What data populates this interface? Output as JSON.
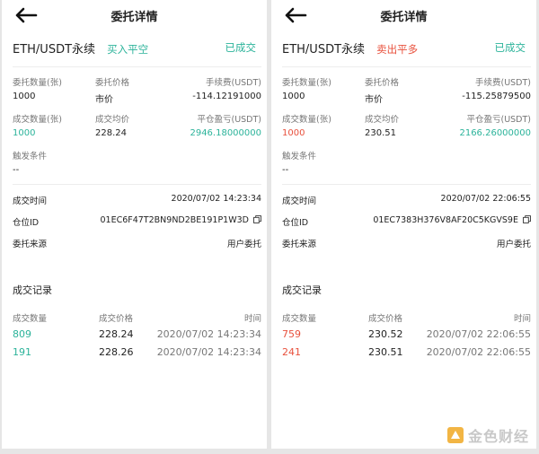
{
  "left": {
    "title": "委托详情",
    "pair": "ETH/USDT永续",
    "side": "买入平空",
    "status": "已成交",
    "labels": {
      "order_qty": "委托数量(张)",
      "order_price": "委托价格",
      "fee": "手续费(USDT)",
      "filled_qty": "成交数量(张)",
      "avg_price": "成交均价",
      "pnl": "平仓盈亏(USDT)",
      "trigger": "触发条件",
      "fill_time": "成交时间",
      "position_id": "仓位ID",
      "source": "委托来源"
    },
    "order_qty": "1000",
    "order_price": "市价",
    "fee": "-114.12191000",
    "filled_qty": "1000",
    "avg_price": "228.24",
    "pnl": "2946.18000000",
    "trigger": "--",
    "fill_time": "2020/07/02 14:23:34",
    "position_id": "01EC6F47T2BN9ND2BE191P1W3D",
    "source": "用户委托",
    "records_title": "成交记录",
    "records_head": {
      "qty": "成交数量",
      "price": "成交价格",
      "time": "时间"
    },
    "records": [
      {
        "qty": "809",
        "price": "228.24",
        "time": "2020/07/02 14:23:34"
      },
      {
        "qty": "191",
        "price": "228.26",
        "time": "2020/07/02 14:23:34"
      }
    ]
  },
  "right": {
    "title": "委托详情",
    "pair": "ETH/USDT永续",
    "side": "卖出平多",
    "status": "已成交",
    "labels": {
      "order_qty": "委托数量(张)",
      "order_price": "委托价格",
      "fee": "手续费(USDT)",
      "filled_qty": "成交数量(张)",
      "avg_price": "成交均价",
      "pnl": "平仓盈亏(USDT)",
      "trigger": "触发条件",
      "fill_time": "成交时间",
      "position_id": "仓位ID",
      "source": "委托来源"
    },
    "order_qty": "1000",
    "order_price": "市价",
    "fee": "-115.25879500",
    "filled_qty": "1000",
    "avg_price": "230.51",
    "pnl": "2166.26000000",
    "trigger": "--",
    "fill_time": "2020/07/02 22:06:55",
    "position_id": "01EC7383H376V8AF20C5KGVS9E",
    "source": "用户委托",
    "records_title": "成交记录",
    "records_head": {
      "qty": "成交数量",
      "price": "成交价格",
      "time": "时间"
    },
    "records": [
      {
        "qty": "759",
        "price": "230.52",
        "time": "2020/07/02 22:06:55"
      },
      {
        "qty": "241",
        "price": "230.51",
        "time": "2020/07/02 22:06:55"
      }
    ]
  },
  "watermark": "金色财经",
  "colors": {
    "buy_green": "#2bb39a",
    "sell_red": "#e8513d",
    "label_gray": "#777777"
  },
  "icons": {
    "back": "arrow-left-icon",
    "copy": "copy-icon",
    "logo": "jinse-logo-icon"
  }
}
